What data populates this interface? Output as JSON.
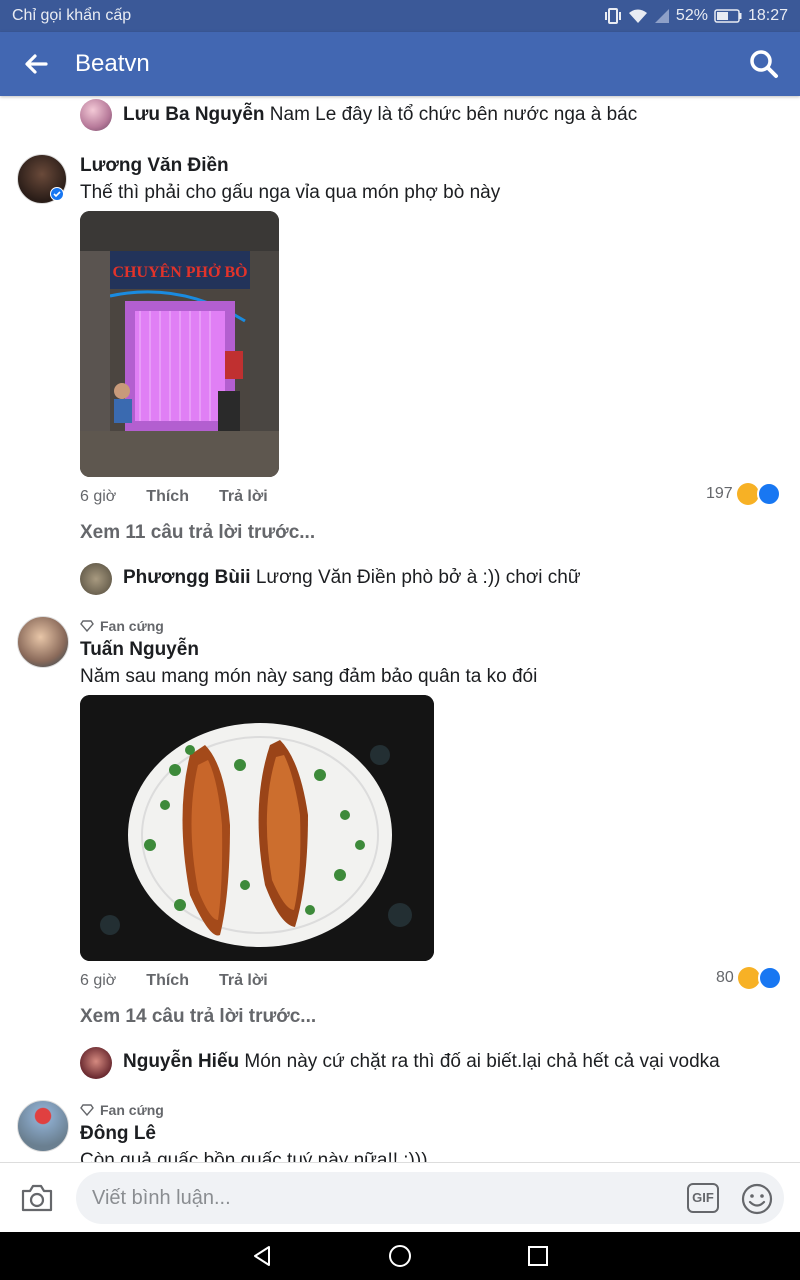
{
  "status_bar": {
    "carrier": "Chỉ gọi khẩn cấp",
    "battery": "52%",
    "time": "18:27"
  },
  "app_bar": {
    "title": "Beatvn",
    "back_icon": "arrow-left-icon",
    "search_icon": "search-icon"
  },
  "comments": [
    {
      "kind": "reply",
      "author": "Lưu Ba Nguyễn",
      "text": "Nam Le đây là tổ chức bên nước nga à bác"
    },
    {
      "kind": "comment",
      "author": "Lương Văn Điền",
      "text": "Thế thì phải cho gấu nga vỉa qua món phợ bò này",
      "photo_sign": "CHUYÊN PHỞ BÒ",
      "time": "6 giờ",
      "like": "Thích",
      "reply": "Trả lời",
      "reactions": "197",
      "view_more": "Xem 11 câu trả lời trước..."
    },
    {
      "kind": "reply",
      "author": "Phươngg Bùii",
      "text": "Lương Văn Điền phò bở à :)) chơi chữ"
    },
    {
      "kind": "comment",
      "badge": "Fan cứng",
      "author": "Tuấn Nguyễn",
      "text": "Năm sau mang món này sang đảm bảo quân ta ko đói",
      "time": "6 giờ",
      "like": "Thích",
      "reply": "Trả lời",
      "reactions": "80",
      "view_more": "Xem 14 câu trả lời trước..."
    },
    {
      "kind": "reply",
      "author": "Nguyễn Hiếu",
      "text": "Món này cứ chặt ra thì đố ai biết.lại chả hết cả vại vodka"
    },
    {
      "kind": "comment",
      "badge": "Fan cứng",
      "author": "Đông Lê",
      "text": "Còn quả quấc bồn quấc tuý này nữa!! :)))"
    }
  ],
  "composer": {
    "placeholder": "Viết bình luận...",
    "gif_label": "GIF",
    "camera_icon": "camera-icon",
    "emoji_icon": "smiley-icon"
  },
  "colors": {
    "status_bar": "#3b5998",
    "app_bar": "#4267b2",
    "meta_text": "#65676b",
    "haha": "#f7b125",
    "like": "#1877f2"
  }
}
